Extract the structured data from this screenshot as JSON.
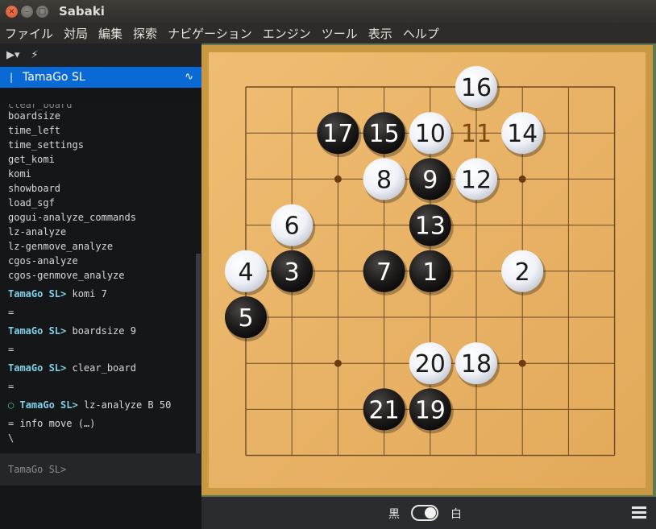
{
  "window": {
    "title": "Sabaki"
  },
  "menubar": [
    "ファイル",
    "対局",
    "編集",
    "探索",
    "ナビゲーション",
    "エンジン",
    "ツール",
    "表示",
    "ヘルプ"
  ],
  "toolbar": {
    "play_icon": "play-circle-icon",
    "flash_icon": "lightning-icon"
  },
  "engine": {
    "name": "TamaGo SL",
    "indicator": "|"
  },
  "console": {
    "partial_line": "clear_board",
    "commands": [
      "boardsize",
      "time_left",
      "time_settings",
      "get_komi",
      "komi",
      "showboard",
      "load_sgf",
      "gogui-analyze_commands",
      "lz-analyze",
      "lz-genmove_analyze",
      "cgos-analyze",
      "cgos-genmove_analyze"
    ],
    "exchanges": [
      {
        "prompt": "TamaGo SL>",
        "command": "komi 7",
        "response": "="
      },
      {
        "prompt": "TamaGo SL>",
        "command": "boardsize 9",
        "response": "="
      },
      {
        "prompt": "TamaGo SL>",
        "command": "clear_board",
        "response": "="
      },
      {
        "prompt": "TamaGo SL>",
        "command": "lz-analyze B 50",
        "response": "= info move (…)"
      }
    ],
    "last_line": "\\",
    "input_prompt": "TamaGo SL>"
  },
  "board": {
    "size": 9,
    "colors": {
      "wood": "#e9b468",
      "frame": "#cf9a47",
      "line": "#6b4a26",
      "black_stone": "#1c1a1a",
      "white_stone": "#f4f6fa"
    },
    "stones": [
      {
        "col": 4,
        "row": 4,
        "color": "black",
        "label": "1"
      },
      {
        "col": 6,
        "row": 4,
        "color": "white",
        "label": "2"
      },
      {
        "col": 1,
        "row": 4,
        "color": "black",
        "label": "3"
      },
      {
        "col": 0,
        "row": 4,
        "color": "white",
        "label": "4"
      },
      {
        "col": 0,
        "row": 5,
        "color": "black",
        "label": "5"
      },
      {
        "col": 1,
        "row": 3,
        "color": "white",
        "label": "6"
      },
      {
        "col": 3,
        "row": 4,
        "color": "black",
        "label": "7"
      },
      {
        "col": 3,
        "row": 2,
        "color": "white",
        "label": "8"
      },
      {
        "col": 4,
        "row": 2,
        "color": "black",
        "label": "9"
      },
      {
        "col": 4,
        "row": 1,
        "color": "white",
        "label": "10"
      },
      {
        "col": 5,
        "row": 1,
        "color": "none",
        "label": "11"
      },
      {
        "col": 5,
        "row": 2,
        "color": "white",
        "label": "12"
      },
      {
        "col": 4,
        "row": 3,
        "color": "black",
        "label": "13"
      },
      {
        "col": 6,
        "row": 1,
        "color": "white",
        "label": "14"
      },
      {
        "col": 3,
        "row": 1,
        "color": "black",
        "label": "15"
      },
      {
        "col": 5,
        "row": 0,
        "color": "white",
        "label": "16"
      },
      {
        "col": 2,
        "row": 1,
        "color": "black",
        "label": "17"
      },
      {
        "col": 5,
        "row": 6,
        "color": "white",
        "label": "18"
      },
      {
        "col": 4,
        "row": 7,
        "color": "black",
        "label": "19"
      },
      {
        "col": 4,
        "row": 6,
        "color": "white",
        "label": "20"
      },
      {
        "col": 3,
        "row": 7,
        "color": "black",
        "label": "21"
      }
    ],
    "hoshi": [
      [
        2,
        2
      ],
      [
        6,
        2
      ],
      [
        2,
        6
      ],
      [
        6,
        6
      ]
    ]
  },
  "bottombar": {
    "black_label": "黒",
    "white_label": "白",
    "menu_icon": "hamburger-menu-icon"
  }
}
